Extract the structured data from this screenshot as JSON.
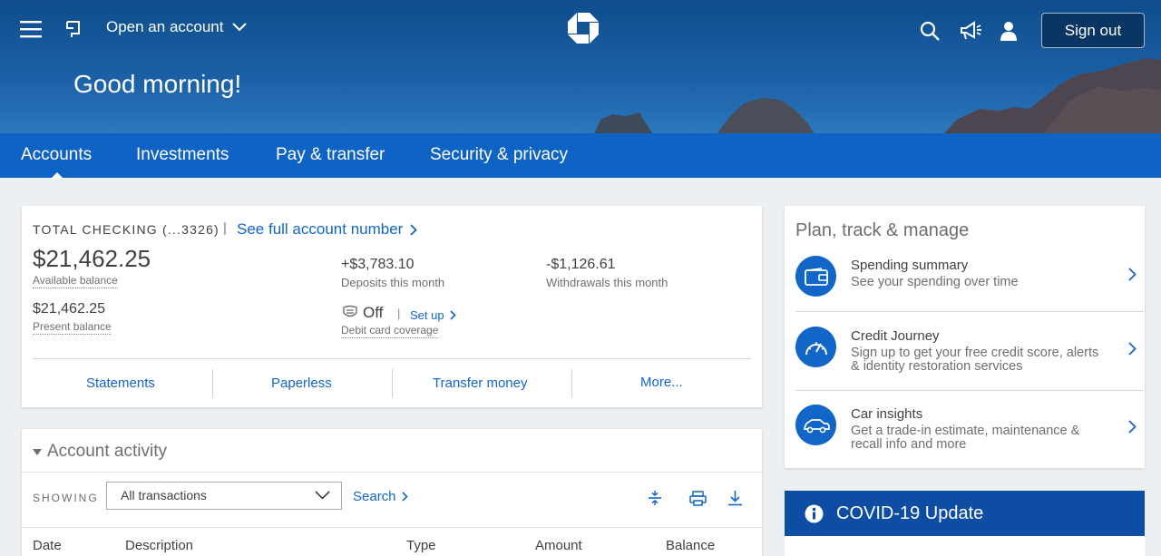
{
  "header": {
    "open_account": "Open an account",
    "greeting": "Good morning!",
    "sign_out": "Sign out"
  },
  "nav": {
    "items": [
      "Accounts",
      "Investments",
      "Pay & transfer",
      "Security & privacy"
    ],
    "active": "Accounts"
  },
  "account": {
    "name": "TOTAL CHECKING (...3326)",
    "full_number_link": "See full account number",
    "available_balance": "$21,462.25",
    "available_label": "Available balance",
    "present_balance": "$21,462.25",
    "present_label": "Present balance",
    "deposits": "+$3,783.10",
    "deposits_label": "Deposits this month",
    "withdrawals": "-$1,126.61",
    "withdrawals_label": "Withdrawals this month",
    "debit_status": "Off",
    "debit_setup": "Set up",
    "debit_label": "Debit card coverage",
    "actions": [
      "Statements",
      "Paperless",
      "Transfer money",
      "More..."
    ]
  },
  "activity": {
    "title": "Account activity",
    "showing_label": "SHOWING",
    "filter_value": "All transactions",
    "search": "Search",
    "columns": [
      "Date",
      "Description",
      "Type",
      "Amount",
      "Balance"
    ]
  },
  "plan": {
    "title": "Plan, track & manage",
    "items": [
      {
        "title": "Spending summary",
        "desc": "See your spending over time",
        "icon": "wallet-icon"
      },
      {
        "title": "Credit Journey",
        "desc": "Sign up to get your free credit score, alerts & identity restoration services",
        "icon": "gauge-icon"
      },
      {
        "title": "Car insights",
        "desc": "Get a trade-in estimate, maintenance & recall info and more",
        "icon": "car-icon"
      }
    ]
  },
  "covid": {
    "title": "COVID-19 Update"
  },
  "colors": {
    "brand": "#0f63c5",
    "link": "#1166c8",
    "covid": "#0e4da4"
  }
}
